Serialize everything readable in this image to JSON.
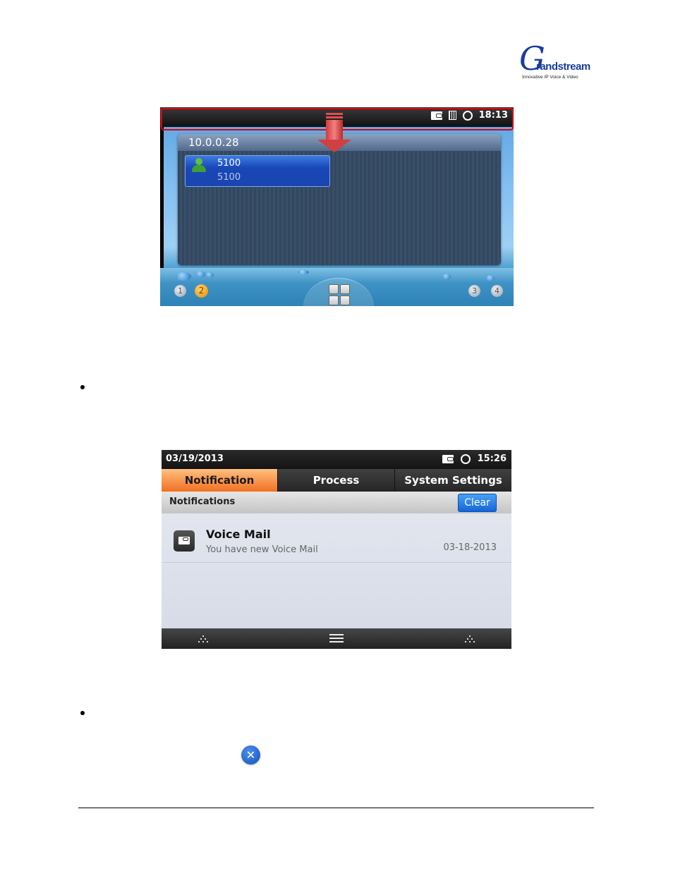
{
  "logo": {
    "mark": "G",
    "wordmark": "randstream",
    "tagline": "Innovative IP Voice & Video"
  },
  "figure1": {
    "status_bar": {
      "time": "18:13",
      "icons": [
        "voicemail-icon",
        "sim-card-icon",
        "network-icon"
      ]
    },
    "highlight_color": "#e00010",
    "arrow_direction": "down",
    "account_panel": {
      "title": "10.0.0.28",
      "account": {
        "name": "5100",
        "number": "5100"
      }
    },
    "pages": [
      "1",
      "2",
      "3",
      "4"
    ],
    "active_page": "2"
  },
  "figure2": {
    "status_bar": {
      "date": "03/19/2013",
      "time": "15:26",
      "icons": [
        "voicemail-icon",
        "network-icon"
      ]
    },
    "tabs": [
      {
        "label": "Notification",
        "active": true
      },
      {
        "label": "Process",
        "active": false
      },
      {
        "label": "System Settings",
        "active": false
      }
    ],
    "subheader": {
      "label": "Notifications",
      "clear_button": "Clear"
    },
    "notifications": [
      {
        "icon": "voicemail-icon",
        "title": "Voice Mail",
        "text": "You have new Voice Mail",
        "date": "03-18-2013"
      }
    ],
    "navbar": [
      "recent-apps-icon",
      "menu-icon",
      "recent-apps-icon"
    ],
    "accent_color": "#f07020"
  },
  "inline_icon": "close-icon",
  "close_glyph": "✕"
}
